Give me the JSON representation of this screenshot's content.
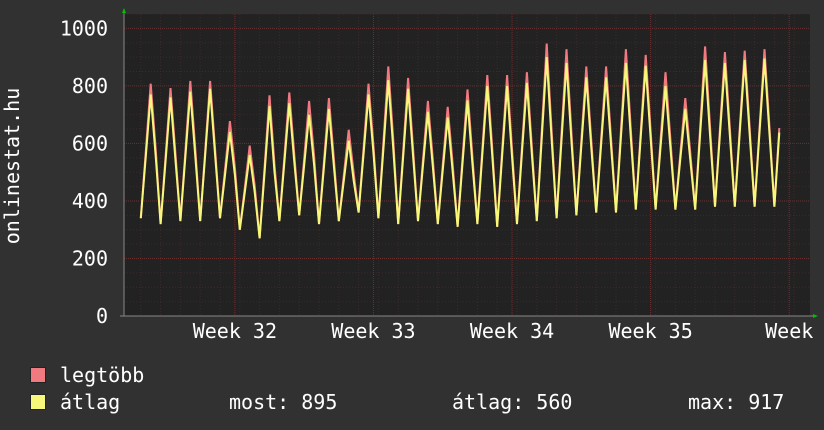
{
  "chart_data": {
    "type": "line",
    "ylabel": "onlinestat.hu",
    "ylim": [
      0,
      1050
    ],
    "yticks": [
      0,
      200,
      400,
      600,
      800,
      1000
    ],
    "x_tick_labels": [
      {
        "label": "Week 32",
        "pos": 0.25
      },
      {
        "label": "Week 33",
        "pos": 1.25
      },
      {
        "label": "Week 34",
        "pos": 2.25
      },
      {
        "label": "Week 35",
        "pos": 3.25
      },
      {
        "label": "Week",
        "pos": 4.25
      }
    ],
    "x_range_weeks": [
      -0.55,
      4.4
    ],
    "grid": true,
    "daily_peaks_max": [
      800,
      785,
      810,
      810,
      670,
      585,
      760,
      770,
      740,
      750,
      640,
      800,
      860,
      820,
      740,
      720,
      780,
      830,
      830,
      840,
      940,
      920,
      860,
      860,
      920,
      900,
      840,
      750,
      930,
      910,
      915,
      920
    ],
    "daily_peaks_avg": [
      770,
      760,
      780,
      790,
      640,
      560,
      730,
      740,
      700,
      720,
      610,
      770,
      820,
      790,
      710,
      690,
      750,
      800,
      800,
      810,
      900,
      880,
      830,
      830,
      880,
      870,
      800,
      720,
      890,
      880,
      890,
      895
    ],
    "daily_troughs": [
      340,
      320,
      330,
      330,
      340,
      300,
      270,
      330,
      350,
      320,
      330,
      360,
      340,
      320,
      330,
      320,
      310,
      320,
      310,
      320,
      330,
      340,
      350,
      360,
      360,
      370,
      370,
      370,
      370,
      380,
      380,
      380
    ],
    "series": [
      {
        "name": "legtöbb",
        "color": "#f07a80"
      },
      {
        "name": "átlag",
        "color": "#f7f77a"
      }
    ]
  },
  "legend": {
    "items": [
      {
        "name": "legtöbb",
        "color": "#f07a80"
      },
      {
        "name": "átlag",
        "color": "#f7f77a"
      }
    ],
    "stat_now": "most: 895",
    "stat_avg": "átlag: 560",
    "stat_max": "max: 917"
  },
  "colors": {
    "background": "#313131",
    "plot_background": "#222222",
    "grid": "#5a3a3a",
    "axis": "#888888",
    "arrow": "#00c000"
  }
}
